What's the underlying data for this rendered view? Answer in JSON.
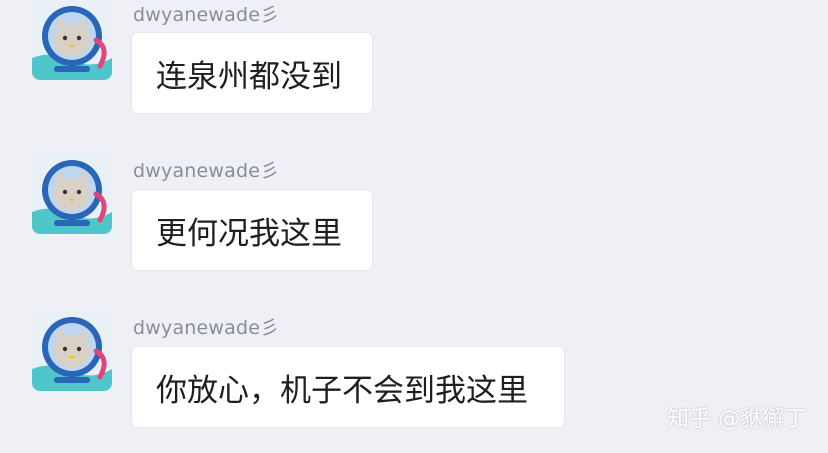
{
  "messages": [
    {
      "sender": "dwyanewade彡",
      "text": "连泉州都没到",
      "avatar_icon": "cat-astronaut-avatar-icon"
    },
    {
      "sender": "dwyanewade彡",
      "text": "更何况我这里",
      "avatar_icon": "cat-astronaut-avatar-icon"
    },
    {
      "sender": "dwyanewade彡",
      "text": "你放心，机子不会到我这里",
      "avatar_icon": "cat-astronaut-avatar-icon"
    }
  ],
  "watermark": "知乎 @貅獬丁",
  "colors": {
    "background": "#eef0f5",
    "bubble": "#ffffff",
    "sender_text": "#8a8d94",
    "message_text": "#1f1f1f"
  }
}
